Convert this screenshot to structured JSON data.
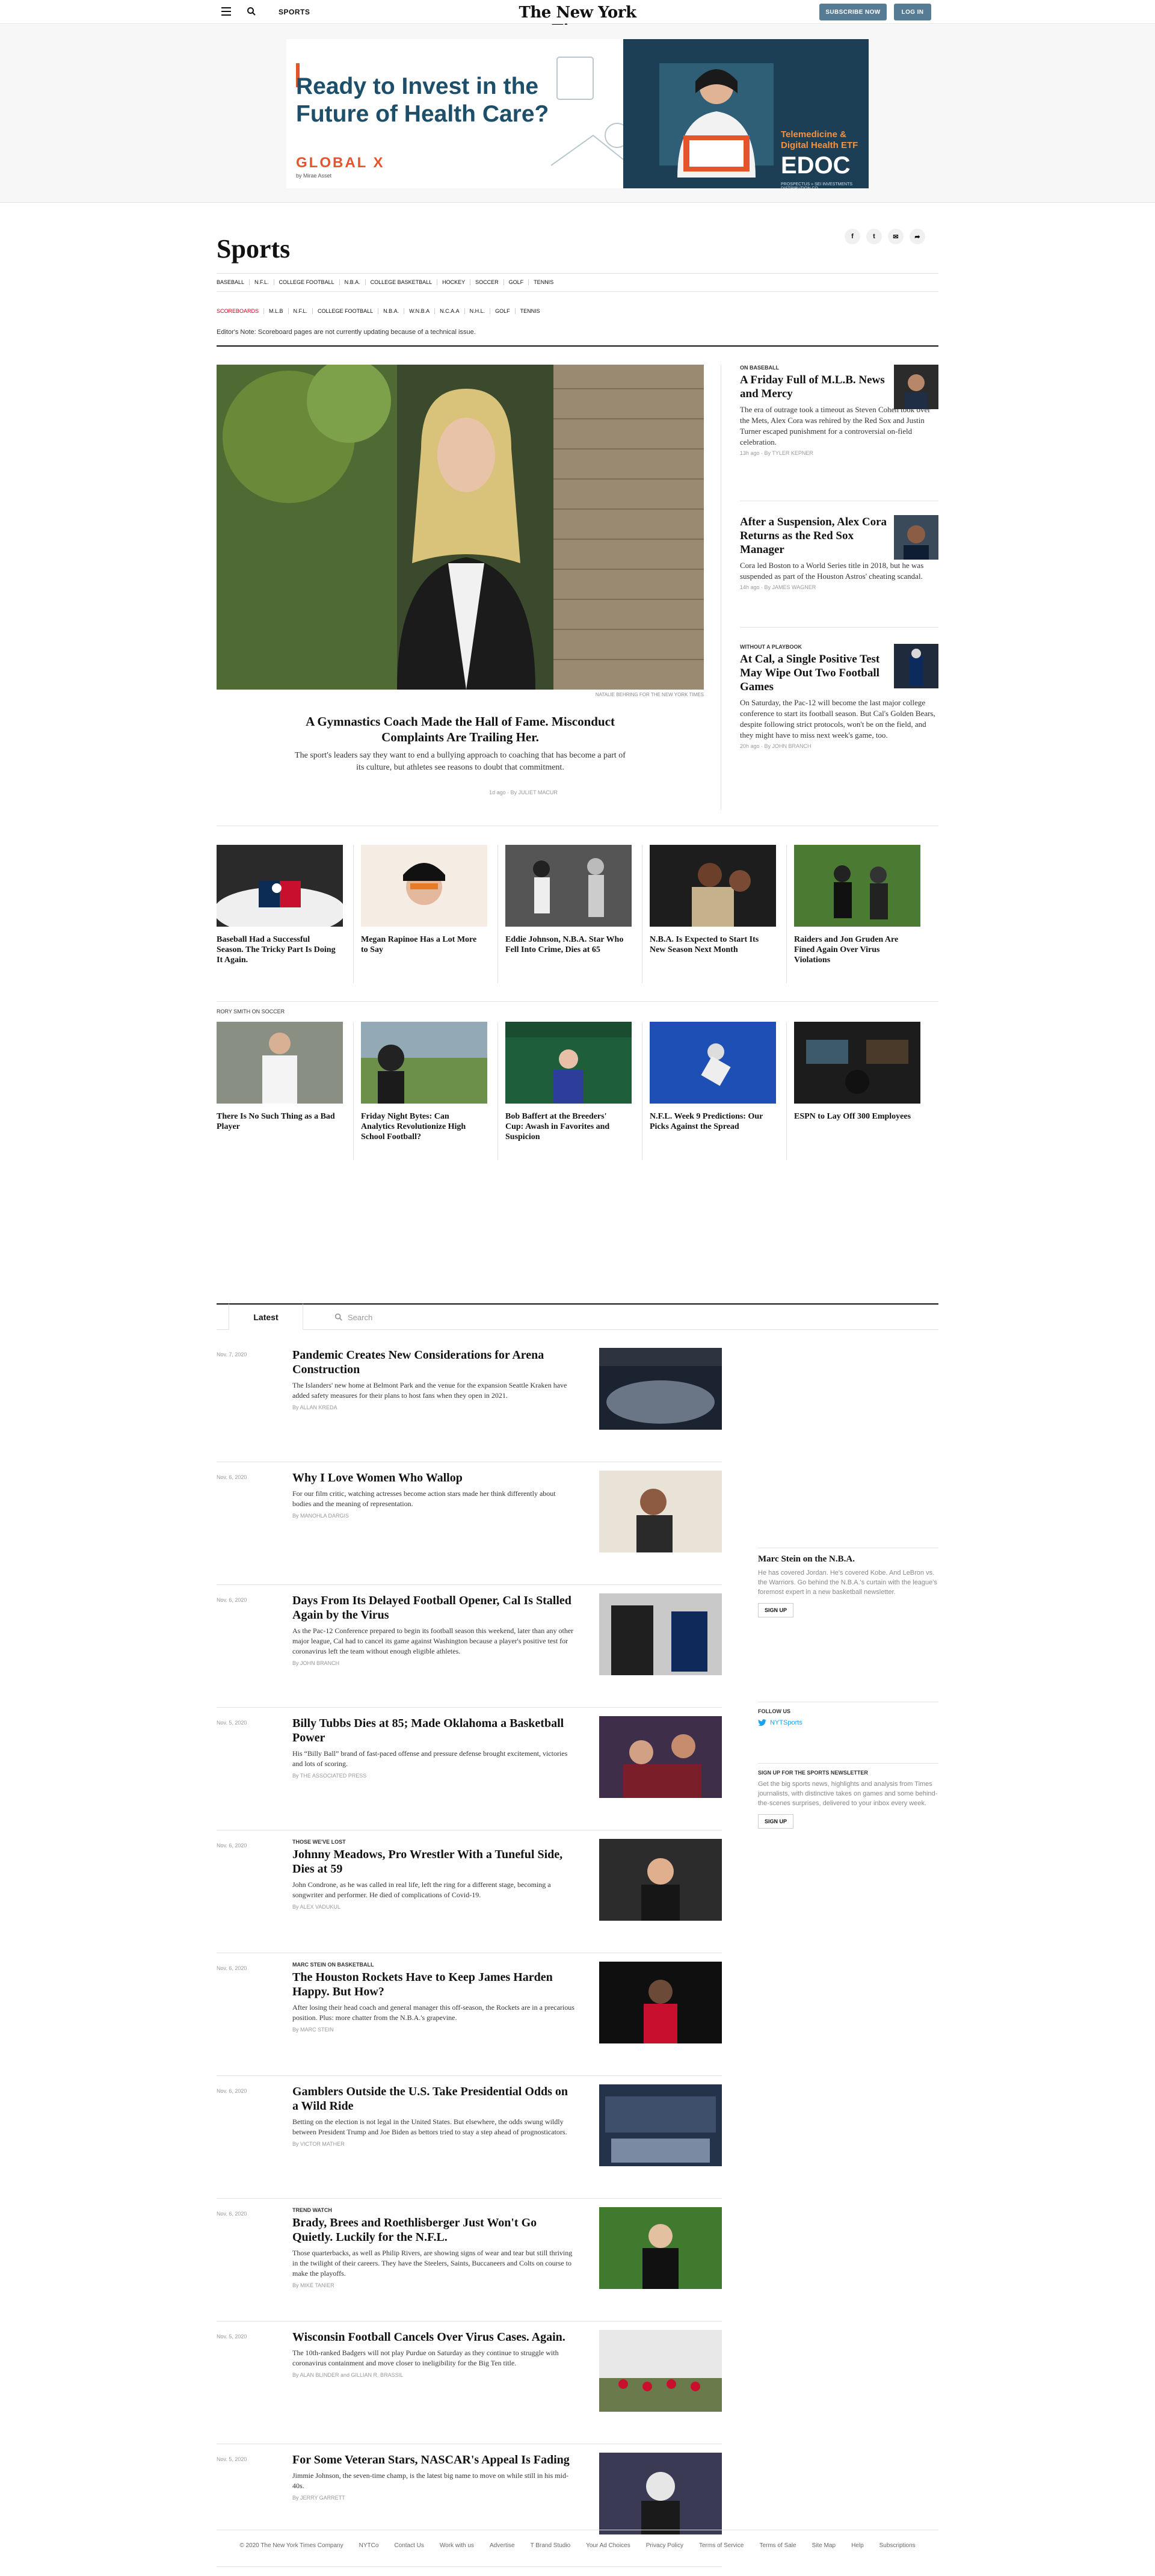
{
  "header": {
    "section": "SPORTS",
    "logo": "The New York Times",
    "subscribe": "SUBSCRIBE NOW",
    "login": "LOG IN"
  },
  "ad": {
    "headline": "Ready to Invest in the Future of Health Care?",
    "brand": "GLOBAL X",
    "brand_sub": "by Mirae Asset",
    "product": "Telemedicine & Digital Health ETF",
    "ticker": "EDOC",
    "prospectus": "PROSPECTUS » SEI INVESTMENTS DISTRIBUTION CO."
  },
  "page": {
    "title": "Sports",
    "share_icons": [
      "facebook-icon",
      "twitter-icon",
      "email-icon",
      "share-icon"
    ],
    "nav": [
      "BASEBALL",
      "N.F.L.",
      "COLLEGE FOOTBALL",
      "N.B.A.",
      "COLLEGE BASKETBALL",
      "HOCKEY",
      "SOCCER",
      "GOLF",
      "TENNIS"
    ],
    "scoreboards": [
      "SCOREBOARDS",
      "M.L.B",
      "N.F.L.",
      "COLLEGE FOOTBALL",
      "N.B.A.",
      "W.N.B.A",
      "N.C.A.A",
      "N.H.L.",
      "GOLF",
      "TENNIS"
    ],
    "note": "Editor's Note: Scoreboard pages are not currently updating because of a technical issue."
  },
  "lead": {
    "credit": "NATALIE BEHRING FOR THE NEW YORK TIMES",
    "headline": "A Gymnastics Coach Made the Hall of Fame. Misconduct Complaints Are Trailing Her.",
    "summary": "The sport's leaders say they want to end a bullying approach to coaching that has become a part of its culture, but athletes see reasons to doubt that commitment.",
    "meta": "1d ago · By JULIET MACUR"
  },
  "side": [
    {
      "kicker": "ON BASEBALL",
      "headline": "A Friday Full of M.L.B. News and Mercy",
      "summary": "The era of outrage took a timeout as Steven Cohen took over the Mets, Alex Cora was rehired by the Red Sox and Justin Turner escaped punishment for a controversial on-field celebration.",
      "meta": "13h ago · By TYLER KEPNER"
    },
    {
      "kicker": "",
      "headline": "After a Suspension, Alex Cora Returns as the Red Sox Manager",
      "summary": "Cora led Boston to a World Series title in 2018, but he was suspended as part of the Houston Astros' cheating scandal.",
      "meta": "14h ago · By JAMES WAGNER"
    },
    {
      "kicker": "WITHOUT A PLAYBOOK",
      "headline": "At Cal, a Single Positive Test May Wipe Out Two Football Games",
      "summary": "On Saturday, the Pac-12 will become the last major college conference to start its football season. But Cal's Golden Bears, despite following strict protocols, won't be on the field, and they might have to miss next week's game, too.",
      "meta": "20h ago · By JOHN BRANCH"
    }
  ],
  "row1": [
    {
      "headline": "Baseball Had a Successful Season. The Tricky Part Is Doing It Again."
    },
    {
      "headline": "Megan Rapinoe Has a Lot More to Say"
    },
    {
      "headline": "Eddie Johnson, N.B.A. Star Who Fell Into Crime, Dies at 65"
    },
    {
      "headline": "N.B.A. Is Expected to Start Its New Season Next Month"
    },
    {
      "headline": "Raiders and Jon Gruden Are Fined Again Over Virus Violations"
    }
  ],
  "row2_kicker": "RORY SMITH ON SOCCER",
  "row2": [
    {
      "headline": "There Is No Such Thing as a Bad Player"
    },
    {
      "headline": "Friday Night Bytes: Can Analytics Revolutionize High School Football?"
    },
    {
      "headline": "Bob Baffert at the Breeders' Cup: Awash in Favorites and Suspicion"
    },
    {
      "headline": "N.F.L. Week 9 Predictions: Our Picks Against the Spread"
    },
    {
      "headline": "ESPN to Lay Off 300 Employees"
    }
  ],
  "tabs": {
    "latest": "Latest",
    "search_placeholder": "Search"
  },
  "stream": [
    {
      "date": "Nov. 7, 2020",
      "kicker": "",
      "headline": "Pandemic Creates New Considerations for Arena Construction",
      "summary": "The Islanders' new home at Belmont Park and the venue for the expansion Seattle Kraken have added safety measures for their plans to host fans when they open in 2021.",
      "byline": "By ALLAN KREDA"
    },
    {
      "date": "Nov. 6, 2020",
      "kicker": "",
      "headline": "Why I Love Women Who Wallop",
      "summary": "For our film critic, watching actresses become action stars made her think differently about bodies and the meaning of representation.",
      "byline": "By MANOHLA DARGIS"
    },
    {
      "date": "Nov. 6, 2020",
      "kicker": "",
      "headline": "Days From Its Delayed Football Opener, Cal Is Stalled Again by the Virus",
      "summary": "As the Pac-12 Conference prepared to begin its football season this weekend, later than any other major league, Cal had to cancel its game against Washington because a player's positive test for coronavirus left the team without enough eligible athletes.",
      "byline": "By JOHN BRANCH"
    },
    {
      "date": "Nov. 5, 2020",
      "kicker": "",
      "headline": "Billy Tubbs Dies at 85; Made Oklahoma a Basketball Power",
      "summary": "His “Billy Ball” brand of fast-paced offense and pressure defense brought excitement, victories and lots of scoring.",
      "byline": "By THE ASSOCIATED PRESS"
    },
    {
      "date": "Nov. 6, 2020",
      "kicker": "THOSE WE'VE LOST",
      "headline": "Johnny Meadows, Pro Wrestler With a Tuneful Side, Dies at 59",
      "summary": "John Condrone, as he was called in real life, left the ring for a different stage, becoming a songwriter and performer. He died of complications of Covid-19.",
      "byline": "By ALEX VADUKUL"
    },
    {
      "date": "Nov. 6, 2020",
      "kicker": "MARC STEIN ON BASKETBALL",
      "headline": "The Houston Rockets Have to Keep James Harden Happy. But How?",
      "summary": "After losing their head coach and general manager this off-season, the Rockets are in a precarious position. Plus: more chatter from the N.B.A.'s grapevine.",
      "byline": "By MARC STEIN"
    },
    {
      "date": "Nov. 6, 2020",
      "kicker": "",
      "headline": "Gamblers Outside the U.S. Take Presidential Odds on a Wild Ride",
      "summary": "Betting on the election is not legal in the United States. But elsewhere, the odds swung wildly between President Trump and Joe Biden as bettors tried to stay a step ahead of prognosticators.",
      "byline": "By VICTOR MATHER"
    },
    {
      "date": "Nov. 6, 2020",
      "kicker": "TREND WATCH",
      "headline": "Brady, Brees and Roethlisberger Just Won't Go Quietly. Luckily for the N.F.L.",
      "summary": "Those quarterbacks, as well as Philip Rivers, are showing signs of wear and tear but still thriving in the twilight of their careers. They have the Steelers, Saints, Buccaneers and Colts on course to make the playoffs.",
      "byline": "By MIKE TANIER"
    },
    {
      "date": "Nov. 5, 2020",
      "kicker": "",
      "headline": "Wisconsin Football Cancels Over Virus Cases. Again.",
      "summary": "The 10th-ranked Badgers will not play Purdue on Saturday as they continue to struggle with coronavirus containment and move closer to ineligibility for the Big Ten title.",
      "byline": "By ALAN BLINDER and GILLIAN R. BRASSIL"
    },
    {
      "date": "Nov. 5, 2020",
      "kicker": "",
      "headline": "For Some Veteran Stars, NASCAR's Appeal Is Fading",
      "summary": "Jimmie Johnson, the seven-time champ, is the latest big name to move on while still in his mid-40s.",
      "byline": "By JERRY GARRETT"
    }
  ],
  "rail": {
    "stein_title": "Marc Stein on the N.B.A.",
    "stein_text": "He has covered Jordan. He's covered Kobe. And LeBron vs. the Warriors. Go behind the N.B.A.'s curtain with the league's foremost expert in a new basketball newsletter.",
    "stein_signup": "SIGN UP",
    "follow_label": "FOLLOW US",
    "follow_handle": "NYTSports",
    "nl_title": "SIGN UP FOR THE SPORTS NEWSLETTER",
    "nl_text": "Get the big sports news, highlights and analysis from Times journalists, with distinctive takes on games and some behind-the-scenes surprises, delivered to your inbox every week.",
    "nl_signup": "SIGN UP"
  },
  "footer": [
    "© 2020 The New York Times Company",
    "NYTCo",
    "Contact Us",
    "Work with us",
    "Advertise",
    "T Brand Studio",
    "Your Ad Choices",
    "Privacy Policy",
    "Terms of Service",
    "Terms of Sale",
    "Site Map",
    "Help",
    "Subscriptions"
  ],
  "colors": {
    "accent_red": "#d0021b",
    "button_blue": "#567b95",
    "twitter_blue": "#1da1f2"
  }
}
